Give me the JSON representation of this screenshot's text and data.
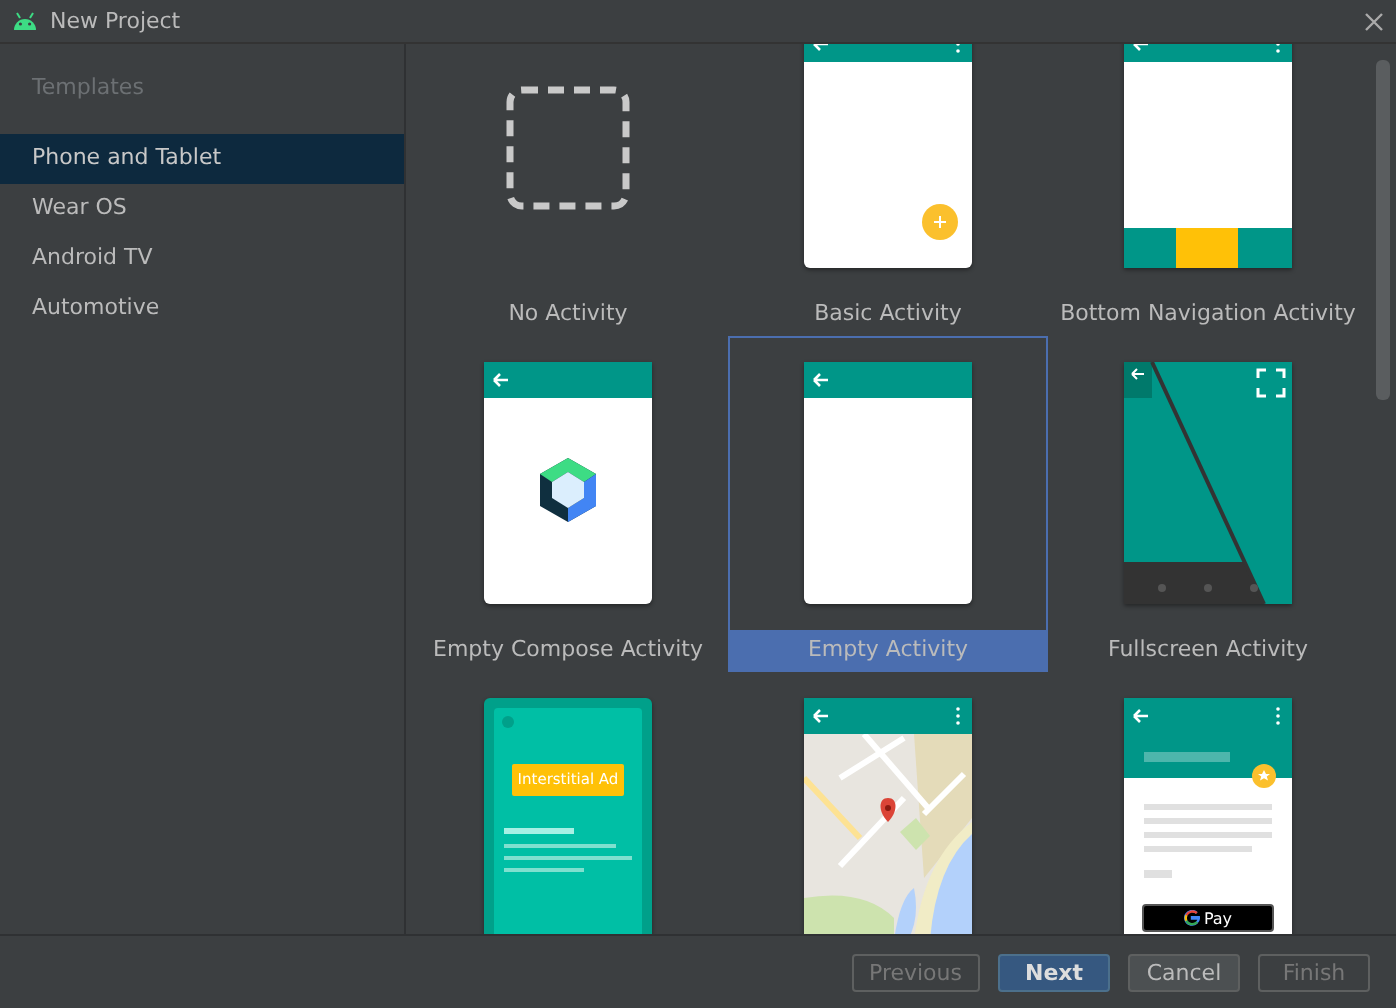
{
  "window": {
    "title": "New Project"
  },
  "sidebar": {
    "header": "Templates",
    "items": [
      {
        "label": "Phone and Tablet",
        "selected": true
      },
      {
        "label": "Wear OS",
        "selected": false
      },
      {
        "label": "Android TV",
        "selected": false
      },
      {
        "label": "Automotive",
        "selected": false
      }
    ]
  },
  "templates": [
    {
      "kind": "none",
      "name": "No Activity",
      "selected": false
    },
    {
      "kind": "basic",
      "name": "Basic Activity",
      "selected": false
    },
    {
      "kind": "bottom-nav",
      "name": "Bottom Navigation Activity",
      "selected": false
    },
    {
      "kind": "compose",
      "name": "Empty Compose Activity",
      "selected": false
    },
    {
      "kind": "empty",
      "name": "Empty Activity",
      "selected": true
    },
    {
      "kind": "fullscreen",
      "name": "Fullscreen Activity",
      "selected": false
    },
    {
      "kind": "interstitial",
      "badge": "Interstitial Ad",
      "selected": false
    },
    {
      "kind": "map",
      "selected": false
    },
    {
      "kind": "gpay",
      "button_text": "Pay",
      "selected": false
    }
  ],
  "buttons": [
    {
      "label": "Previous",
      "kind": "secondary",
      "disabled": true
    },
    {
      "label": "Next",
      "kind": "primary",
      "disabled": false
    },
    {
      "label": "Cancel",
      "kind": "secondary",
      "disabled": false
    },
    {
      "label": "Finish",
      "kind": "secondary",
      "disabled": true
    }
  ]
}
